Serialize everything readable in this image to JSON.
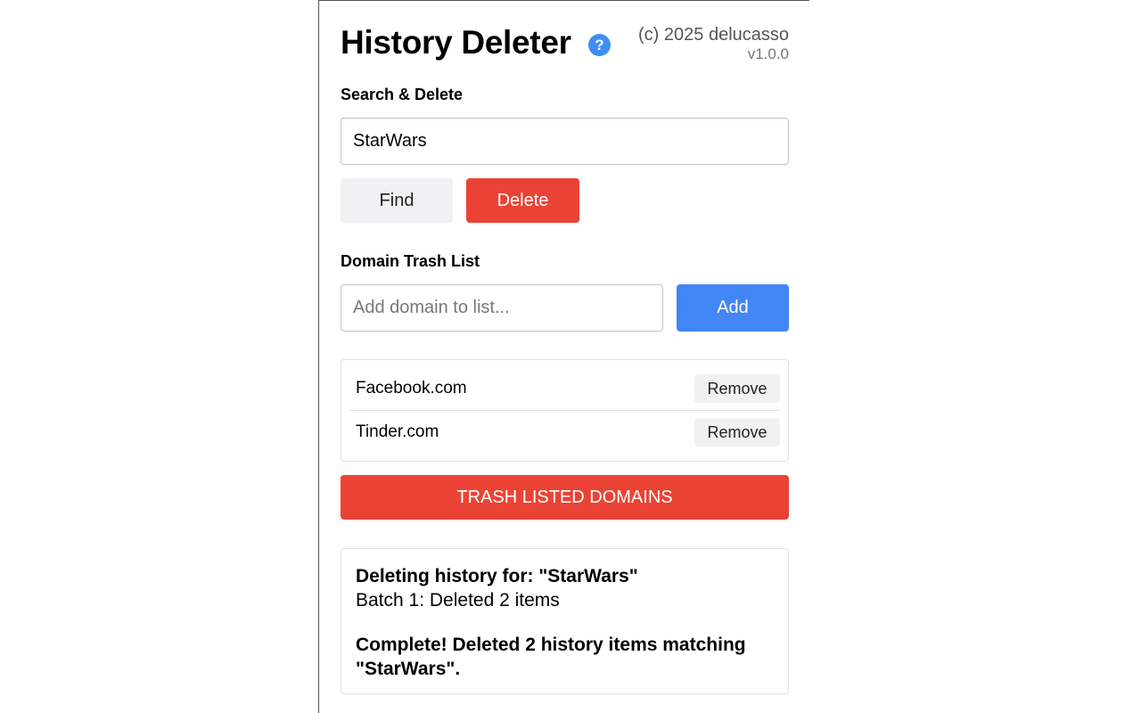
{
  "header": {
    "title": "History Deleter",
    "help_glyph": "?",
    "copyright": "(c) 2025 delucasso",
    "version": "v1.0.0"
  },
  "search": {
    "label": "Search & Delete",
    "value": "StarWars",
    "find_label": "Find",
    "delete_label": "Delete"
  },
  "trash": {
    "label": "Domain Trash List",
    "placeholder": "Add domain to list...",
    "add_label": "Add",
    "domains": [
      {
        "name": "Facebook.com",
        "remove_label": "Remove"
      },
      {
        "name": "Tinder.com",
        "remove_label": "Remove"
      }
    ],
    "trash_all_label": "TRASH LISTED DOMAINS"
  },
  "log": {
    "line1": "Deleting history for: \"StarWars\"",
    "line2": "Batch 1: Deleted 2 items",
    "line3": "Complete! Deleted 2 history items matching \"StarWars\"."
  },
  "colors": {
    "accent_blue": "#4285f4",
    "danger_red": "#ea4335",
    "help_icon": "#3f8df2"
  },
  "icons": {
    "help": "question-circle-icon"
  }
}
